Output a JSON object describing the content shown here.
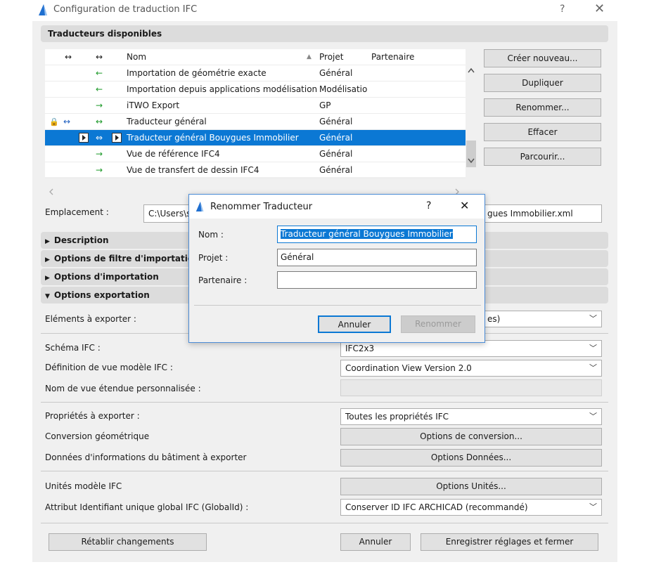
{
  "window": {
    "title": "Configuration de traduction IFC",
    "help": "?",
    "close": "✕"
  },
  "translators": {
    "header": "Traducteurs disponibles",
    "columns": {
      "nom": "Nom",
      "projet": "Projet",
      "partenaire": "Partenaire",
      "sort": "▲",
      "col1": "↔",
      "col2": "↔"
    },
    "rows": [
      {
        "dir": "←",
        "nom": "Importation de géométrie exacte",
        "projet": "Général",
        "lock": "",
        "bi": ""
      },
      {
        "dir": "←",
        "nom": "Importation depuis applications modélisation",
        "projet": "Modélisatio",
        "lock": "",
        "bi": ""
      },
      {
        "dir": "→",
        "nom": "iTWO Export",
        "projet": "GP",
        "lock": "",
        "bi": ""
      },
      {
        "dir": "↔",
        "nom": "Traducteur général",
        "projet": "Général",
        "lock": "🔒",
        "bi": "↔"
      },
      {
        "dir": "⇔",
        "nom": "Traducteur général Bouygues Immobilier",
        "projet": "Général",
        "lock": "",
        "bi": ""
      },
      {
        "dir": "→",
        "nom": "Vue de référence IFC4",
        "projet": "Général",
        "lock": "",
        "bi": ""
      },
      {
        "dir": "→",
        "nom": "Vue de transfert de dessin IFC4",
        "projet": "Général",
        "lock": "",
        "bi": ""
      }
    ],
    "buttons": {
      "create": "Créer nouveau...",
      "duplicate": "Dupliquer",
      "rename": "Renommer...",
      "delete": "Effacer",
      "browse": "Parcourir..."
    }
  },
  "location": {
    "label": "Emplacement :",
    "value_start": "C:\\Users\\s",
    "value_end": "gues Immobilier.xml"
  },
  "sections": {
    "description": "Description",
    "filter": "Options de filtre d'importation/",
    "import": "Options d'importation",
    "export": "Options exportation"
  },
  "export": {
    "elements_label": "Eléments à exporter :",
    "elements_value": "es)",
    "schema_label": "Schéma IFC :",
    "schema_value": "IFC2x3",
    "mvd_label": "Définition de vue modèle IFC :",
    "mvd_value": "Coordination View Version 2.0",
    "custom_label": "Nom de vue étendue personnalisée :",
    "props_label": "Propriétés à exporter :",
    "props_value": "Toutes les propriétés IFC",
    "geom_label": "Conversion géométrique",
    "geom_button": "Options de conversion...",
    "data_label": "Données d'informations du bâtiment à exporter",
    "data_button": "Options Données...",
    "units_label": "Unités modèle IFC",
    "units_button": "Options Unités...",
    "guid_label": "Attribut Identifiant unique global IFC (GlobalId) :",
    "guid_value": "Conserver ID IFC ARCHICAD (recommandé)"
  },
  "footer": {
    "reset": "Rétablir changements",
    "cancel": "Annuler",
    "save": "Enregistrer réglages et fermer"
  },
  "dialog": {
    "title": "Renommer Traducteur",
    "help": "?",
    "close": "✕",
    "nom_label": "Nom :",
    "nom_value": "Traducteur général Bouygues Immobilier",
    "projet_label": "Projet :",
    "projet_value": "Général",
    "partenaire_label": "Partenaire :",
    "partenaire_value": "",
    "cancel": "Annuler",
    "ok": "Renommer"
  }
}
